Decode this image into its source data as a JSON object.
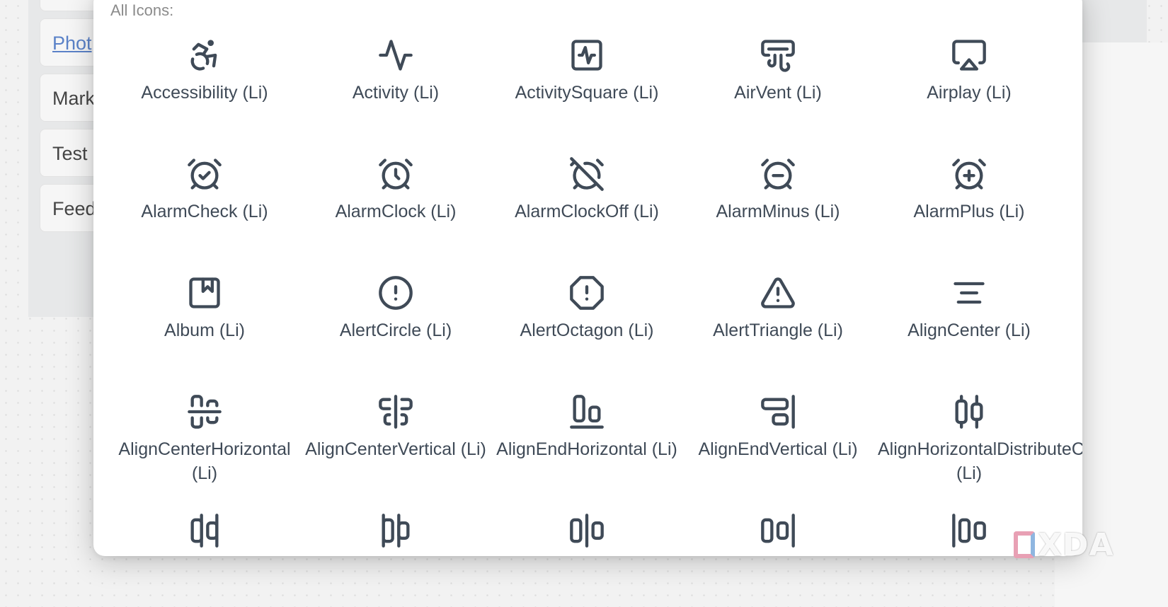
{
  "background_items": [
    {
      "label": "",
      "link": false
    },
    {
      "label": "Phot",
      "link": true
    },
    {
      "label": "Mark",
      "link": false
    },
    {
      "label": "Test",
      "link": false
    },
    {
      "label": "Feed",
      "link": false
    }
  ],
  "modal": {
    "section_label": "All Icons:",
    "icons": [
      {
        "label": "Accessibility (Li)",
        "icon": "accessibility-icon"
      },
      {
        "label": "Activity (Li)",
        "icon": "activity-icon"
      },
      {
        "label": "ActivitySquare (Li)",
        "icon": "activity-square-icon"
      },
      {
        "label": "AirVent (Li)",
        "icon": "air-vent-icon"
      },
      {
        "label": "Airplay (Li)",
        "icon": "airplay-icon"
      },
      {
        "label": "AlarmCheck (Li)",
        "icon": "alarm-check-icon"
      },
      {
        "label": "AlarmClock (Li)",
        "icon": "alarm-clock-icon"
      },
      {
        "label": "AlarmClockOff (Li)",
        "icon": "alarm-clock-off-icon"
      },
      {
        "label": "AlarmMinus (Li)",
        "icon": "alarm-minus-icon"
      },
      {
        "label": "AlarmPlus (Li)",
        "icon": "alarm-plus-icon"
      },
      {
        "label": "Album (Li)",
        "icon": "album-icon"
      },
      {
        "label": "AlertCircle (Li)",
        "icon": "alert-circle-icon"
      },
      {
        "label": "AlertOctagon (Li)",
        "icon": "alert-octagon-icon"
      },
      {
        "label": "AlertTriangle (Li)",
        "icon": "alert-triangle-icon"
      },
      {
        "label": "AlignCenter (Li)",
        "icon": "align-center-icon"
      },
      {
        "label": "AlignCenterHorizontal (Li)",
        "icon": "align-center-horizontal-icon"
      },
      {
        "label": "AlignCenterVertical (Li)",
        "icon": "align-center-vertical-icon"
      },
      {
        "label": "AlignEndHorizontal (Li)",
        "icon": "align-end-horizontal-icon"
      },
      {
        "label": "AlignEndVertical (Li)",
        "icon": "align-end-vertical-icon"
      },
      {
        "label": "AlignHorizontalDistributeCenter (Li)",
        "icon": "align-horizontal-distribute-center-icon"
      },
      {
        "label": "",
        "icon": "align-horizontal-distribute-end-icon"
      },
      {
        "label": "",
        "icon": "align-horizontal-distribute-start-icon"
      },
      {
        "label": "",
        "icon": "align-horizontal-justify-center-icon"
      },
      {
        "label": "",
        "icon": "align-horizontal-justify-end-icon"
      },
      {
        "label": "",
        "icon": "align-horizontal-justify-start-icon"
      }
    ]
  },
  "watermark": {
    "text": "XDA"
  },
  "colors": {
    "icon_stroke": "#3f4a57",
    "label_text": "#3f4a57",
    "section_label": "#8b8b8b",
    "link": "#5b82c8"
  }
}
